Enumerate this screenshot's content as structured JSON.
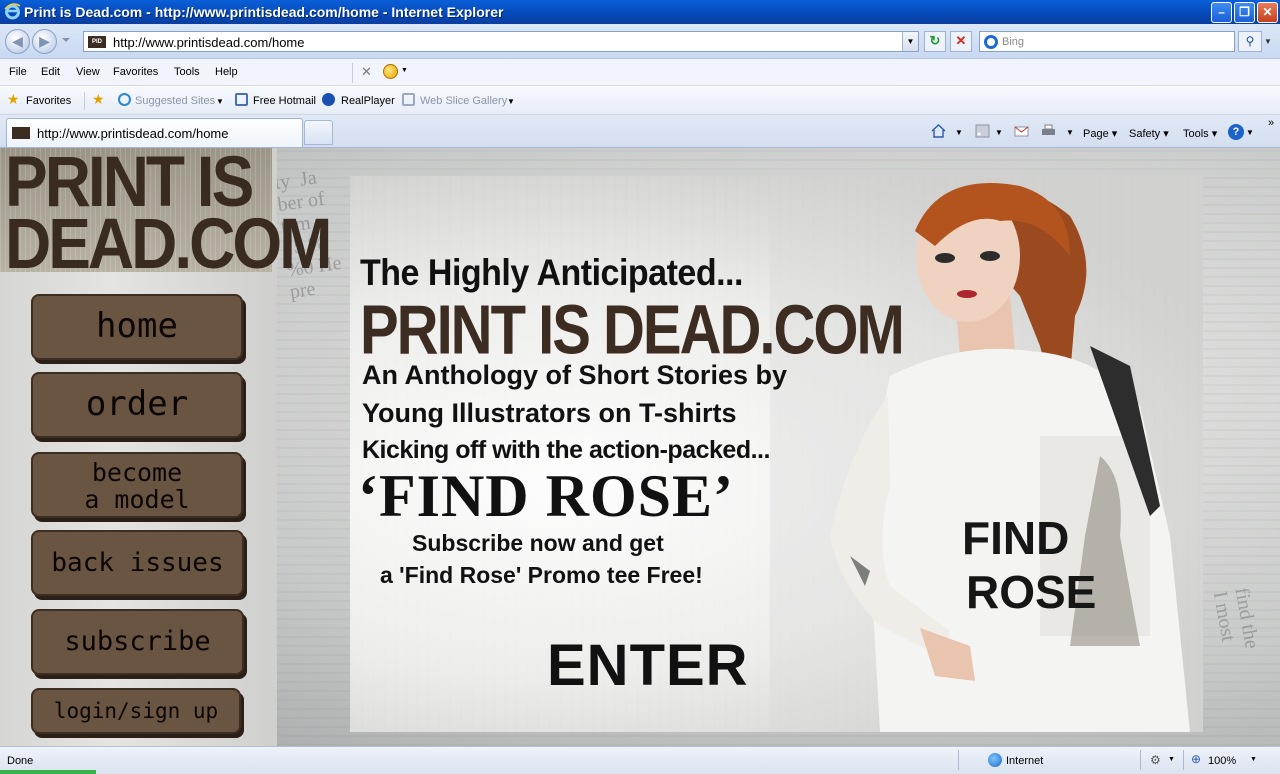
{
  "window": {
    "title": "Print is Dead.com - http://www.printisdead.com/home - Internet Explorer",
    "minimize": "–",
    "maximize": "❐",
    "close": "✕"
  },
  "address": {
    "url": "http://www.printisdead.com/home",
    "search_placeholder": "Bing",
    "back_glyph": "◀",
    "forward_glyph": "▶",
    "refresh_glyph": "↻",
    "stop_glyph": "✕",
    "search_glyph": "⚲",
    "favicon_text": "PID"
  },
  "menu": {
    "items": [
      "File",
      "Edit",
      "View",
      "Favorites",
      "Tools",
      "Help"
    ]
  },
  "favorites": {
    "favorites_label": "Favorites",
    "suggested": "Suggested Sites",
    "hotmail": "Free Hotmail",
    "realplayer": "RealPlayer",
    "webslice": "Web Slice Gallery"
  },
  "tab": {
    "label": "http://www.printisdead.com/home"
  },
  "commands": {
    "page": "Page",
    "safety": "Safety",
    "tools": "Tools",
    "help_glyph": "?"
  },
  "site": {
    "logo_line1": "PRINT IS",
    "logo_line2": "DEAD.COM",
    "nav": {
      "home": "home",
      "order": "order",
      "become_line1": "become",
      "become_line2": "a model",
      "back_issues": "back issues",
      "subscribe": "subscribe",
      "login": "login/sign up"
    },
    "banner": {
      "line1": "The Highly Anticipated...",
      "line2": "PRINT IS DEAD.COM",
      "line3": "An Anthology of Short Stories by",
      "line4": "Young Illustrators on T-shirts",
      "line5": "Kicking off with the action-packed...",
      "line6": "‘FIND ROSE’",
      "line7": "Subscribe now and get",
      "line8": "a 'Find Rose' Promo tee Free!",
      "enter": "ENTER",
      "shirt_line1": "FIND",
      "shirt_line2": "ROSE"
    }
  },
  "status": {
    "text": "Done",
    "zone": "Internet",
    "zoom": "100%"
  },
  "colors": {
    "button_fill": "#6a5542",
    "logo_text": "#3a2b20",
    "titlebar": "#0a5fd8"
  }
}
